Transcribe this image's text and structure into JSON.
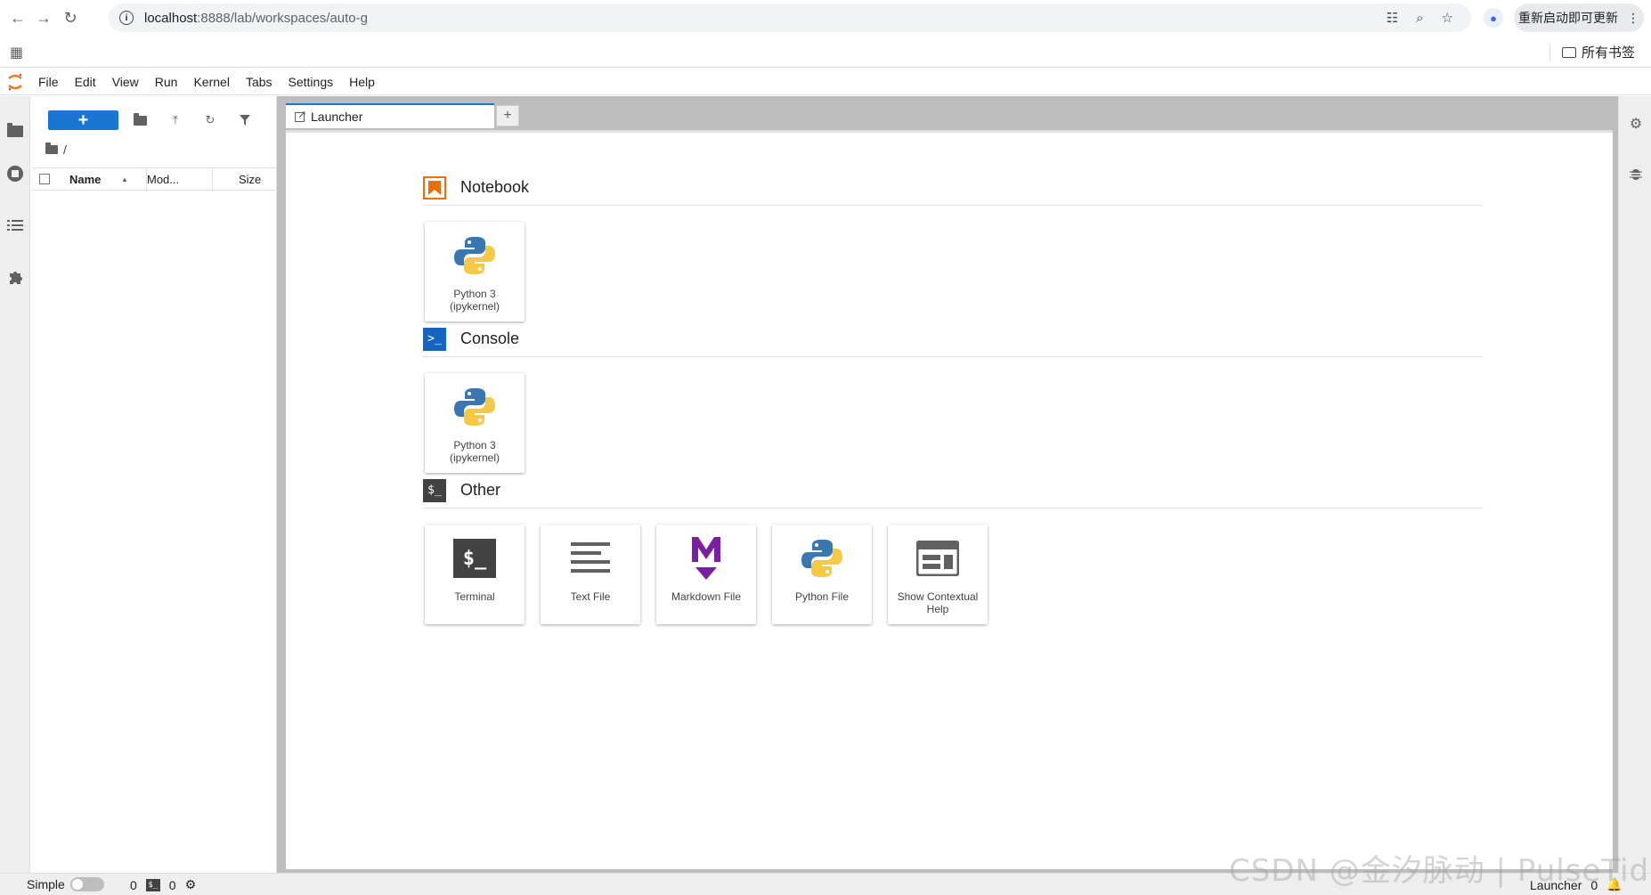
{
  "browser": {
    "url_host": "localhost",
    "url_path": ":8888/lab/workspaces/auto-g",
    "update_button": "重新启动即可更新",
    "all_bookmarks": "所有书签"
  },
  "menu": [
    "File",
    "Edit",
    "View",
    "Run",
    "Kernel",
    "Tabs",
    "Settings",
    "Help"
  ],
  "file_browser": {
    "new_button": "+",
    "breadcrumb": "/",
    "columns": {
      "name": "Name",
      "modified": "Mod...",
      "size": "Size"
    }
  },
  "tabs": {
    "launcher": "Launcher",
    "add": "+"
  },
  "launcher": {
    "notebook": {
      "title": "Notebook",
      "cards": [
        "Python 3 (ipykernel)"
      ]
    },
    "console": {
      "title": "Console",
      "cards": [
        "Python 3 (ipykernel)"
      ]
    },
    "other": {
      "title": "Other",
      "cards": [
        "Terminal",
        "Text File",
        "Markdown File",
        "Python File",
        "Show Contextual Help"
      ]
    }
  },
  "status": {
    "simple_label": "Simple",
    "terminals_count": "0",
    "kernels_count": "0",
    "active_tab": "Launcher",
    "notifications": "0"
  },
  "watermark": "CSDN @金汐脉动 | PulseTide",
  "colors": {
    "accent": "#1976d2",
    "notebook_icon": "#ef6c00",
    "console_icon": "#1565c0",
    "markdown_icon": "#7b1fa2"
  }
}
